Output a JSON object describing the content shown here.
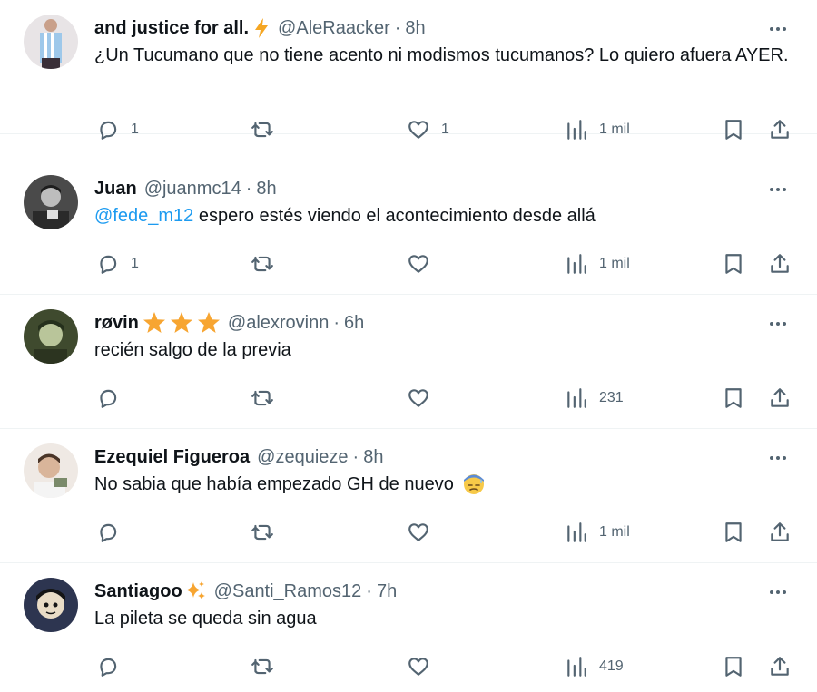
{
  "tweets": [
    {
      "display_name": "and justice for all.",
      "name_emoji": "lightning-emoji",
      "handle": "@AleRaacker",
      "time": "8h",
      "text": "¿Un Tucumano que no tiene acento ni modismos tucumanos? Lo quiero afuera AYER.",
      "mention": "",
      "replies": "1",
      "retweets": "",
      "likes": "1",
      "views": "1 mil"
    },
    {
      "display_name": "Juan",
      "name_emoji": "",
      "handle": "@juanmc14",
      "time": "8h",
      "text": " espero estés viendo el acontecimiento desde allá",
      "mention": "@fede_m12",
      "replies": "1",
      "retweets": "",
      "likes": "",
      "views": "1 mil"
    },
    {
      "display_name": "røvin",
      "name_emoji": "three-stars-emoji",
      "handle": "@alexrovinn",
      "time": "6h",
      "text": "recién salgo de la previa",
      "mention": "",
      "replies": "",
      "retweets": "",
      "likes": "",
      "views": "231"
    },
    {
      "display_name": "Ezequiel Figueroa",
      "name_emoji": "",
      "handle": "@zequieze",
      "time": "8h",
      "text": "No sabia que había empezado GH de nuevo",
      "text_emoji": "downcast-sweat-face-emoji",
      "mention": "",
      "replies": "",
      "retweets": "",
      "likes": "",
      "views": "1 mil"
    },
    {
      "display_name": "Santiagoo",
      "name_emoji": "sparkles-emoji",
      "handle": "@Santi_Ramos12",
      "time": "7h",
      "text": "La pileta se queda sin agua",
      "mention": "",
      "replies": "",
      "retweets": "",
      "likes": "",
      "views": "419"
    }
  ],
  "separator": "·",
  "icons": {
    "reply": "reply-icon",
    "retweet": "retweet-icon",
    "like": "heart-icon",
    "views": "views-icon",
    "bookmark": "bookmark-icon",
    "share": "share-icon",
    "more": "more-icon"
  },
  "colors": {
    "text": "#0f1419",
    "secondary": "#536471",
    "link": "#1d9bf0",
    "border": "#eff3f4",
    "star": "#f7a531",
    "lightning": "#f5a623"
  }
}
